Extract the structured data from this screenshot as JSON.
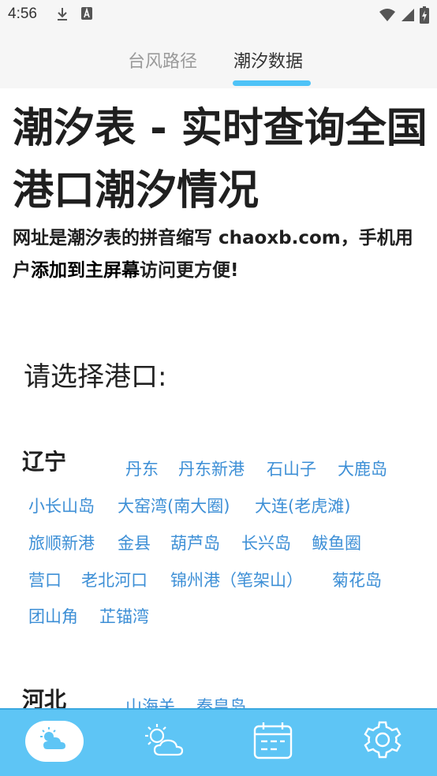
{
  "status_bar": {
    "time": "4:56",
    "icons": [
      "download-icon",
      "a-box-icon",
      "wifi-icon",
      "signal-icon",
      "battery-icon"
    ]
  },
  "top_tabs": [
    {
      "label": "台风路径",
      "active": false
    },
    {
      "label": "潮汐数据",
      "active": true
    }
  ],
  "page": {
    "title": "潮汐表 - 实时查询全国港口潮汐情况",
    "notice_part1": "网址是潮汐表的拼音缩写 chaoxb.com，手机用户",
    "notice_highlight": "添加到主屏幕",
    "notice_part2": "访问更方便!",
    "select_prompt": "请选择港口:"
  },
  "provinces": [
    {
      "name": "辽宁",
      "ports": [
        "丹东",
        "丹东新港",
        "石山子",
        "大鹿岛",
        "小长山岛",
        "大窑湾(南大圈)",
        "大连(老虎滩)",
        "旅顺新港",
        "金县",
        "葫芦岛",
        "长兴岛",
        "鲅鱼圈",
        "营口",
        "老北河口",
        "锦州港（笔架山）",
        "菊花岛",
        "团山角",
        "芷锚湾"
      ]
    },
    {
      "name": "河北",
      "ports": [
        "山海关",
        "秦皇岛"
      ]
    }
  ],
  "bottom_nav": [
    {
      "icon": "weather-cloud-sun-icon",
      "active": true
    },
    {
      "icon": "sun-cloud-icon",
      "active": false
    },
    {
      "icon": "calendar-icon",
      "active": false
    },
    {
      "icon": "settings-gear-icon",
      "active": false
    }
  ],
  "colors": {
    "accent": "#4fc3f7",
    "nav_background": "#5ec5f5",
    "port_link": "#3d8fd6"
  }
}
